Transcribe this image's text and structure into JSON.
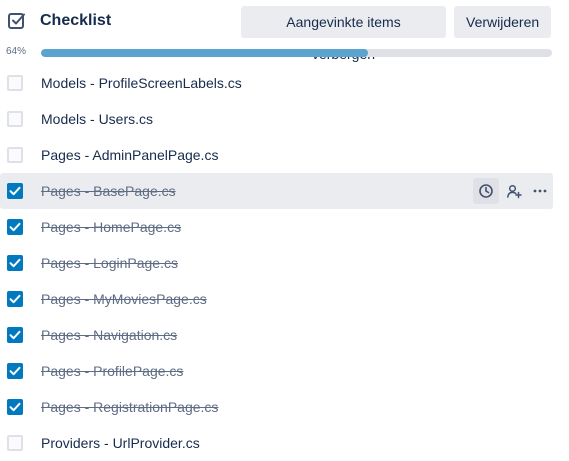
{
  "header": {
    "title": "Checklist",
    "hide_checked_label": "Aangevinkte items verbergen",
    "delete_label": "Verwijderen"
  },
  "progress": {
    "label": "64%",
    "value": 0.64
  },
  "items": [
    {
      "label": "Models - ProfileScreenLabels.cs",
      "checked": false
    },
    {
      "label": "Models - Users.cs",
      "checked": false
    },
    {
      "label": "Pages - AdminPanelPage.cs",
      "checked": false
    },
    {
      "label": "Pages - BasePage.cs",
      "checked": true,
      "hovered": true
    },
    {
      "label": "Pages - HomePage.cs",
      "checked": true
    },
    {
      "label": "Pages - LoginPage.cs",
      "checked": true
    },
    {
      "label": "Pages - MyMoviesPage.cs",
      "checked": true
    },
    {
      "label": "Pages - Navigation.cs",
      "checked": true
    },
    {
      "label": "Pages - ProfilePage.cs",
      "checked": true
    },
    {
      "label": "Pages - RegistrationPage.cs",
      "checked": true
    },
    {
      "label": "Providers - UrlProvider.cs",
      "checked": false
    }
  ],
  "item_actions": {
    "icons": [
      "clock-icon",
      "add-member-icon",
      "more-icon"
    ]
  },
  "colors": {
    "accent": "#0079bf",
    "progress": "#5ba4cf",
    "text": "#172b4d",
    "muted": "#5e6c84",
    "button_bg": "#ebecf0"
  }
}
